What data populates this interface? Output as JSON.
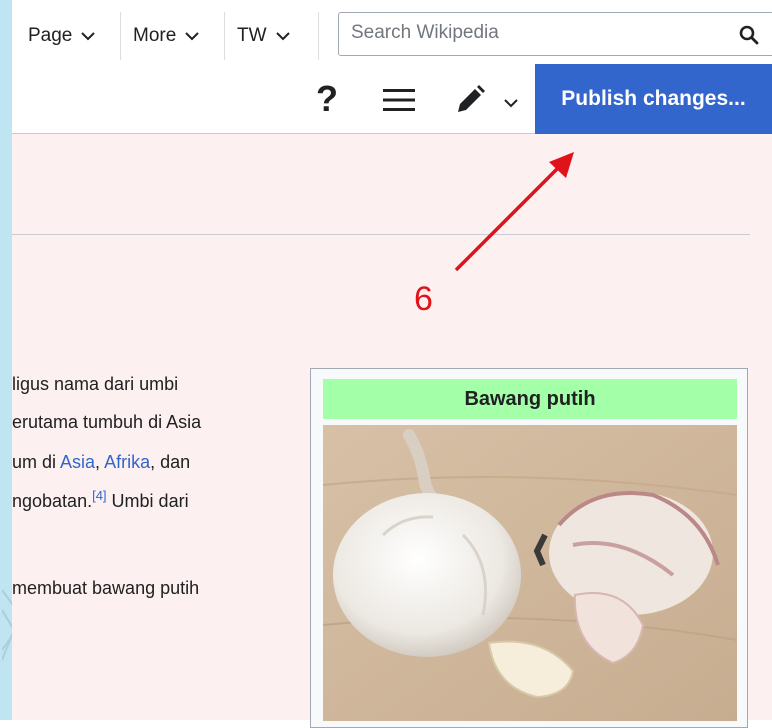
{
  "tabs": [
    {
      "label": "Page"
    },
    {
      "label": "More"
    },
    {
      "label": "TW"
    }
  ],
  "search": {
    "placeholder": "Search Wikipedia",
    "icon": "search-icon"
  },
  "toolbar": {
    "help_label": "?",
    "menu_icon": "hamburger-menu-icon",
    "edit_icon": "pencil-icon",
    "publish_label": "Publish changes..."
  },
  "article": {
    "line1": "ligus nama dari umbi",
    "line2": "erutama tumbuh di Asia",
    "line3_pre": "um di ",
    "line3_link1": "Asia",
    "line3_mid": ", ",
    "line3_link2": "Afrika",
    "line3_post": ", dan",
    "line4_pre": "ngobatan.",
    "line4_ref": "[4]",
    "line4_post": " Umbi dari",
    "line5": " membuat bawang putih"
  },
  "infobox": {
    "title": "Bawang putih",
    "image": "garlic-photo"
  },
  "annotation": {
    "step": "6"
  },
  "colors": {
    "publish_bg": "#3366cc",
    "content_bg": "#fdf0f0",
    "infobox_title_bg": "#a3ffa8",
    "annotation": "#e0131b",
    "link": "#3366cc"
  }
}
